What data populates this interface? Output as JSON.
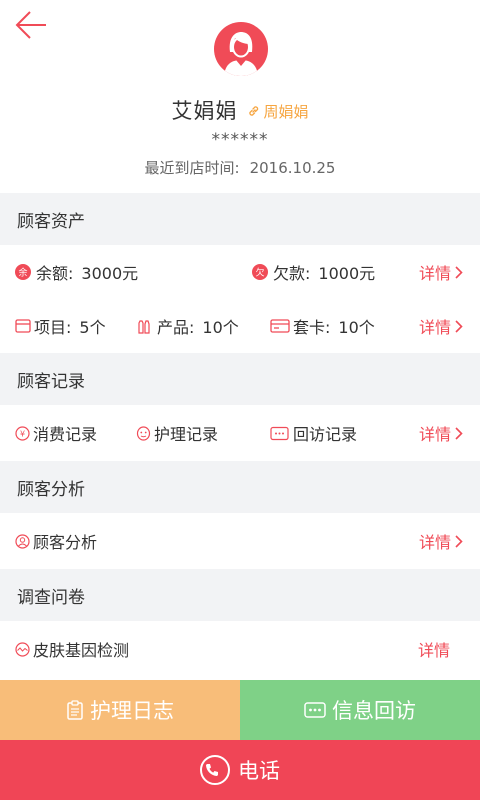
{
  "header": {
    "name": "艾娟娟",
    "nickname": "周娟娟",
    "phone_masked": "******",
    "last_visit_label": "最近到店时间:",
    "last_visit_date": "2016.10.25"
  },
  "assets": {
    "title": "顾客资产",
    "balance_label": "余额:",
    "balance_value": "3000元",
    "balance_badge": "余",
    "debt_label": "欠款:",
    "debt_value": "1000元",
    "debt_badge": "欠",
    "project_label": "项目:",
    "project_value": "5个",
    "product_label": "产品:",
    "product_value": "10个",
    "card_label": "套卡:",
    "card_value": "10个",
    "detail_label": "详情"
  },
  "records": {
    "title": "顾客记录",
    "consume": "消费记录",
    "care": "护理记录",
    "revisit": "回访记录",
    "detail_label": "详情"
  },
  "analysis": {
    "title": "顾客分析",
    "item": "顾客分析",
    "detail_label": "详情"
  },
  "survey": {
    "title": "调查问卷",
    "item": "皮肤基因检测",
    "detail_label": "详情"
  },
  "actions": {
    "care_log": "护理日志",
    "info_revisit": "信息回访",
    "call": "电话"
  },
  "colors": {
    "accent": "#f04b57",
    "nickname": "#f6a540",
    "care_log_bg": "#f8bd79",
    "revisit_bg": "#7fd187",
    "call_bg": "#f04556",
    "section_bg": "#f2f3f5"
  }
}
